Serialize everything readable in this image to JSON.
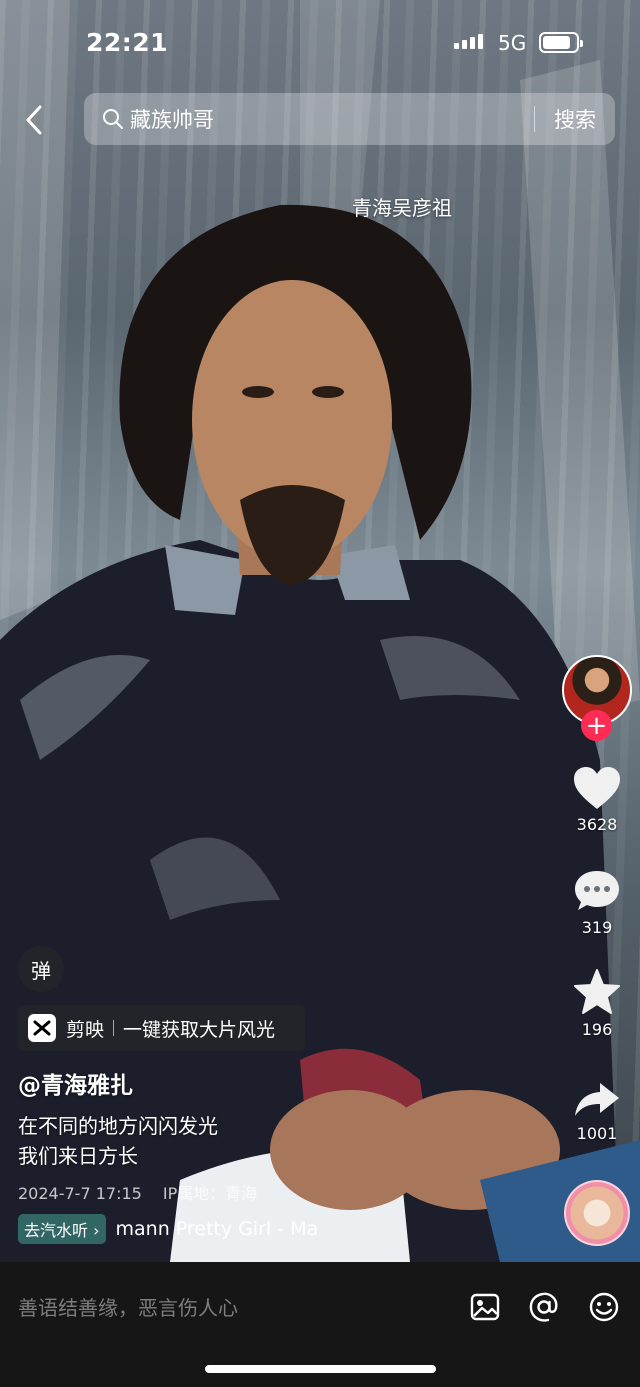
{
  "status": {
    "time": "22:21",
    "network": "5G",
    "battery_level": 0.85
  },
  "search": {
    "query": "藏族帅哥",
    "button": "搜索"
  },
  "video": {
    "caption": "青海吴彦祖"
  },
  "actions": {
    "likes": "3628",
    "comments": "319",
    "favorites": "196",
    "shares": "1001"
  },
  "overlays": {
    "danmu": "弹"
  },
  "capcut": {
    "brand": "剪映",
    "text": "一键获取大片风光"
  },
  "post": {
    "author": "@青海雅扎",
    "line1": "在不同的地方闪闪发光",
    "line2": "我们来日方长",
    "date": "2024-7-7 17:15",
    "location": "IP属地：青海"
  },
  "music": {
    "tag": "去汽水听",
    "text": "mann   Pretty Girl - Ma"
  },
  "comment": {
    "placeholder": "善语结善缘，恶言伤人心"
  },
  "icons": {
    "back": "chevron-left-icon",
    "search": "search-icon",
    "like": "heart-icon",
    "comment": "comment-bubble-icon",
    "favorite": "star-icon",
    "share": "share-arrow-icon",
    "image": "image-icon",
    "mention": "at-icon",
    "emoji": "emoji-icon"
  },
  "colors": {
    "follow": "#fe2c55",
    "comment_bar": "#161616"
  }
}
